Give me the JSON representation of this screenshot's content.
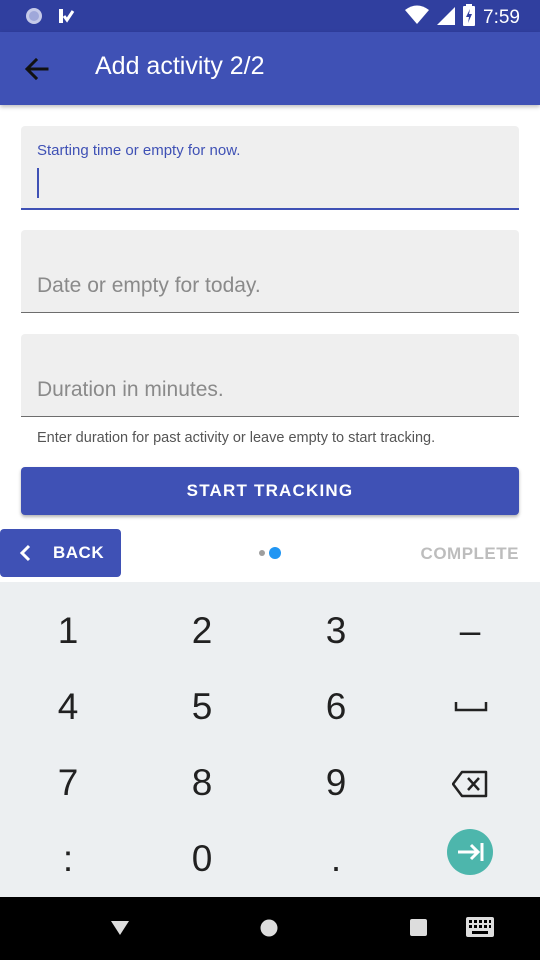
{
  "status_bar": {
    "time": "7:59"
  },
  "app_bar": {
    "title": "Add activity 2/2"
  },
  "form": {
    "start_time_label": "Starting time or empty for now.",
    "date_placeholder": "Date or empty for today.",
    "duration_placeholder": "Duration in minutes.",
    "helper_text": "Enter duration for past activity or leave empty to start tracking.",
    "start_button": "START TRACKING"
  },
  "wizard_nav": {
    "back_label": "BACK",
    "complete_label": "COMPLETE",
    "page_count": 2,
    "current_page": 2
  },
  "keyboard": {
    "keys": [
      "1",
      "2",
      "3",
      "–",
      "4",
      "5",
      "6",
      "7",
      "8",
      "9",
      ":",
      "0",
      "."
    ]
  },
  "colors": {
    "primary": "#3f51b5",
    "primary_dark": "#303f9f",
    "accent": "#2196f3",
    "go_key": "#4db6ac"
  }
}
